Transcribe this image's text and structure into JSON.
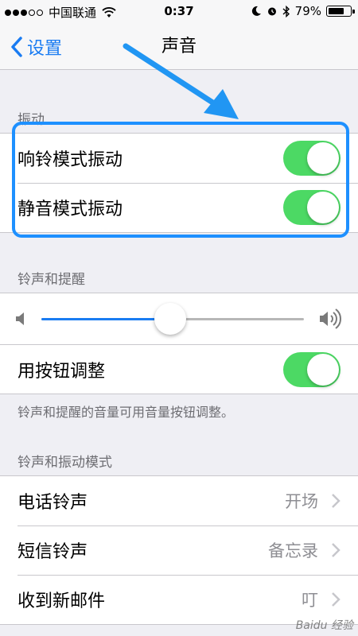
{
  "status_bar": {
    "carrier": "中国联通",
    "time": "0:37",
    "battery_percent": "79%",
    "battery_level": 0.79,
    "signal_bars_filled": 3,
    "signal_bars_total": 5
  },
  "nav": {
    "back_label": "设置",
    "title": "声音"
  },
  "sections": {
    "vibrate": {
      "header": "振动",
      "rows": [
        {
          "label": "响铃模式振动",
          "toggle_on": true
        },
        {
          "label": "静音模式振动",
          "toggle_on": true
        }
      ]
    },
    "ringer": {
      "header": "铃声和提醒",
      "volume_level": 0.49,
      "change_with_buttons": {
        "label": "用按钮调整",
        "toggle_on": true
      },
      "footer": "铃声和提醒的音量可用音量按钮调整。"
    },
    "sounds": {
      "header": "铃声和振动模式",
      "rows": [
        {
          "label": "电话铃声",
          "value": "开场"
        },
        {
          "label": "短信铃声",
          "value": "备忘录"
        },
        {
          "label": "收到新邮件",
          "value": "叮"
        }
      ]
    }
  },
  "watermark": "Baidu 经验",
  "colors": {
    "accent": "#1a7cf2",
    "toggle_on": "#4cd964",
    "highlight": "#1e90ff",
    "background": "#efeff4"
  },
  "icons": {
    "back": "chevron-left-icon",
    "row_disclosure": "chevron-right-icon",
    "volume_low": "speaker-low-icon",
    "volume_high": "speaker-high-icon",
    "wifi": "wifi-icon",
    "moon": "moon-icon",
    "alarm": "alarm-icon",
    "bluetooth": "bluetooth-icon",
    "battery": "battery-icon"
  }
}
